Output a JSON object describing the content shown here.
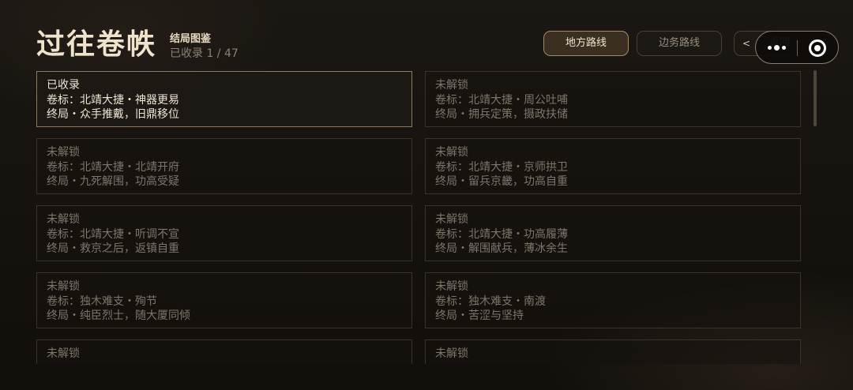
{
  "header": {
    "title": "过往卷帙",
    "subtitle": "结局图鉴",
    "progress": "已收录 1 / 47"
  },
  "tabs": [
    {
      "label": "地方路线",
      "active": true
    },
    {
      "label": "边务路线",
      "active": false
    }
  ],
  "back_button": {
    "label": "返回",
    "icon": "back-arrow-icon"
  },
  "capsule": {
    "menu_icon": "more-dots-icon",
    "close_icon": "target-circle-icon"
  },
  "colors": {
    "accent": "#a48a62",
    "background": "#15120e",
    "text_primary": "#efe6d4",
    "text_locked": "#7e7669"
  },
  "cards": [
    {
      "status": "已收录",
      "tag": "卷标：北靖大捷・神器更易",
      "ending": "终局・众手推戴，旧鼎移位",
      "unlocked": true
    },
    {
      "status": "未解锁",
      "tag": "卷标：北靖大捷・周公吐哺",
      "ending": "终局・拥兵定策，摄政扶储",
      "unlocked": false
    },
    {
      "status": "未解锁",
      "tag": "卷标：北靖大捷・北靖开府",
      "ending": "终局・九死解围，功高受疑",
      "unlocked": false
    },
    {
      "status": "未解锁",
      "tag": "卷标：北靖大捷・京师拱卫",
      "ending": "终局・留兵京畿，功高自重",
      "unlocked": false
    },
    {
      "status": "未解锁",
      "tag": "卷标：北靖大捷・听调不宣",
      "ending": "终局・救京之后，返镇自重",
      "unlocked": false
    },
    {
      "status": "未解锁",
      "tag": "卷标：北靖大捷・功高履薄",
      "ending": "终局・解围献兵，薄冰余生",
      "unlocked": false
    },
    {
      "status": "未解锁",
      "tag": "卷标：独木难支・殉节",
      "ending": "终局・纯臣烈士，随大厦同倾",
      "unlocked": false
    },
    {
      "status": "未解锁",
      "tag": "卷标：独木难支・南渡",
      "ending": "终局・苦涩与坚持",
      "unlocked": false
    },
    {
      "status": "未解锁",
      "tag": "",
      "ending": "",
      "unlocked": false
    },
    {
      "status": "未解锁",
      "tag": "",
      "ending": "",
      "unlocked": false
    }
  ]
}
